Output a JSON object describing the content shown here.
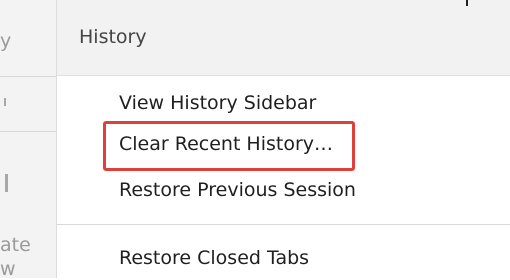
{
  "background": {
    "fragments": [
      "y",
      "ate",
      "w"
    ]
  },
  "menu": {
    "header_title": "History",
    "items": [
      {
        "label": "View History Sidebar"
      },
      {
        "label": "Clear Recent History…"
      },
      {
        "label": "Restore Previous Session"
      },
      {
        "label": "Restore Closed Tabs"
      }
    ],
    "highlighted_item_index": 1
  },
  "colors": {
    "highlight_border": "#e0403c",
    "header_bg": "#f2f2f2",
    "text": "#1f1f1f",
    "header_text": "#444444"
  }
}
